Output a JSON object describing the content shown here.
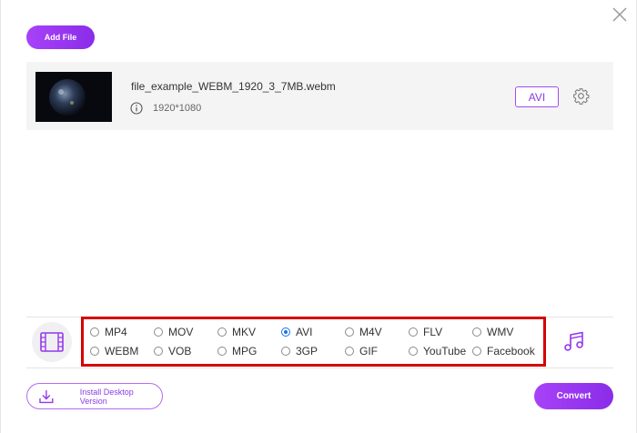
{
  "header": {
    "add_file_label": "Add File"
  },
  "file": {
    "name": "file_example_WEBM_1920_3_7MB.webm",
    "resolution": "1920*1080",
    "output_format": "AVI"
  },
  "formats": {
    "selected": "AVI",
    "row1": [
      "MP4",
      "MOV",
      "MKV",
      "AVI",
      "M4V",
      "FLV",
      "WMV"
    ],
    "row2": [
      "WEBM",
      "VOB",
      "MPG",
      "3GP",
      "GIF",
      "YouTube",
      "Facebook"
    ]
  },
  "footer": {
    "install_label": "Install Desktop Version",
    "convert_label": "Convert"
  },
  "colors": {
    "accent": "#9436ee",
    "highlight_border": "#d60000",
    "radio_selected": "#1a73e8"
  },
  "icons": {
    "close": "close-icon",
    "info": "info-icon",
    "settings": "gear-icon",
    "video": "film-icon",
    "audio": "music-note-icon",
    "download": "download-icon"
  }
}
